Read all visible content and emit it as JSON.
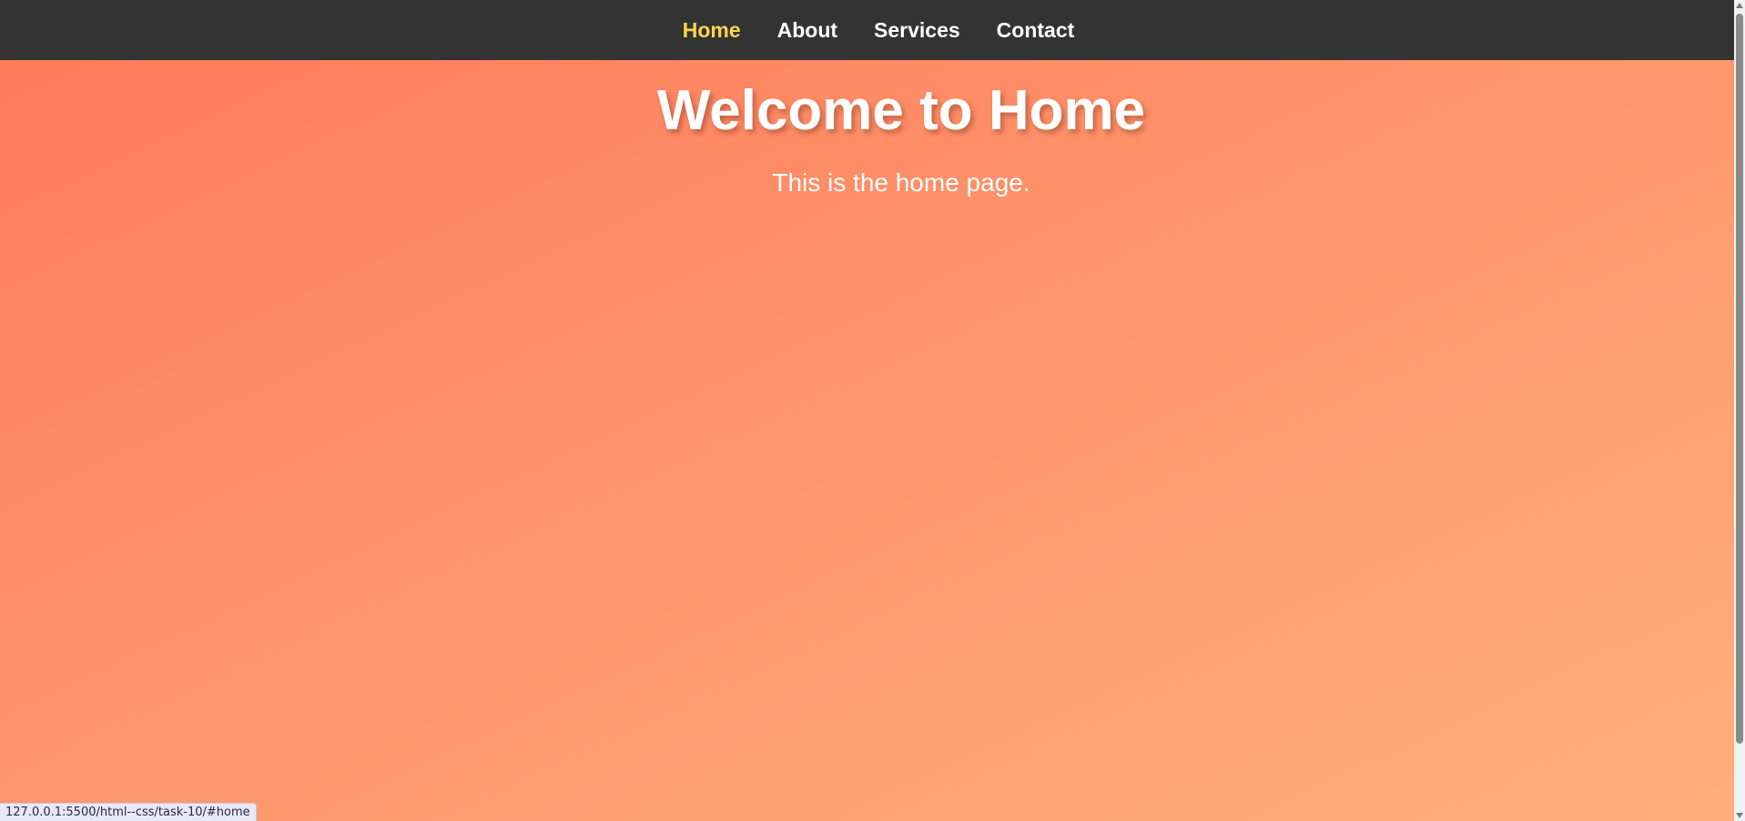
{
  "nav": {
    "links": [
      {
        "label": "Home",
        "active": true
      },
      {
        "label": "About",
        "active": false
      },
      {
        "label": "Services",
        "active": false
      },
      {
        "label": "Contact",
        "active": false
      }
    ]
  },
  "hero": {
    "title": "Welcome to Home",
    "text": "This is the home page."
  },
  "status_bar": {
    "url": "127.0.0.1:5500/html--css/task-10/#home"
  },
  "colors": {
    "navbar": "#333333",
    "active_link": "#ffd54f",
    "gradient_start": "#ff7b5a",
    "gradient_end": "#ffb07a"
  }
}
